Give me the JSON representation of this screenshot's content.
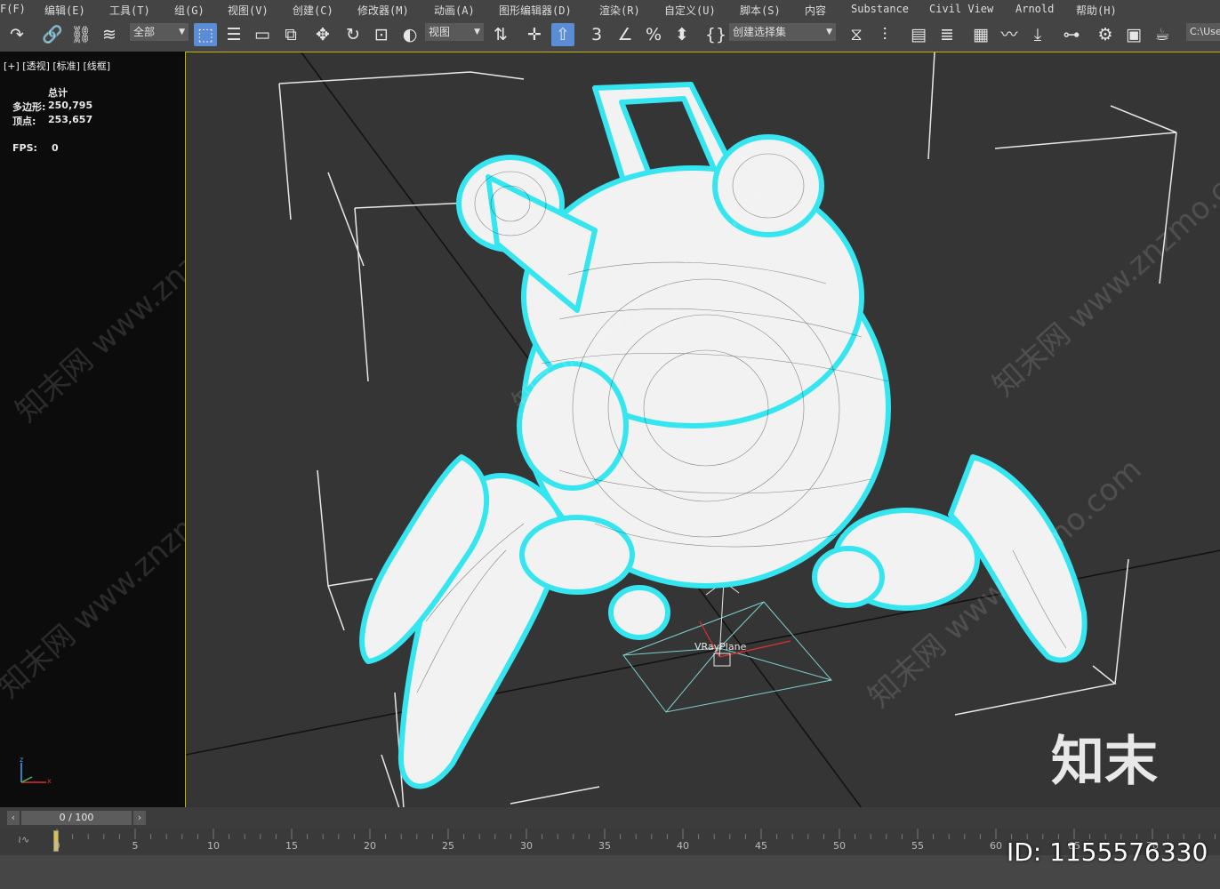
{
  "menubar": {
    "items": [
      "F(F)",
      "编辑(E)",
      "工具(T)",
      "组(G)",
      "视图(V)",
      "创建(C)",
      "修改器(M)",
      "动画(A)",
      "图形编辑器(D)",
      "渲染(R)",
      "自定义(U)",
      "脚本(S)",
      "内容",
      "Substance",
      "Civil View",
      "Arnold",
      "帮助(H)"
    ]
  },
  "toolbar": {
    "selection_filter": "全部",
    "reference_coord": "视图",
    "named_selection": "创建选择集",
    "path_display": "C:\\Use"
  },
  "viewport": {
    "label": "[+] [透视] [标准] [线框]",
    "stats_header": "总计",
    "polys_label": "多边形:",
    "polys_value": "250,795",
    "verts_label": "顶点:",
    "verts_value": "253,657",
    "fps_label": "FPS:",
    "fps_value": "0",
    "object_label": "VRayPlane",
    "watermark": "知末网 www.znzmo.com"
  },
  "timeslider": {
    "counter": "0 / 100",
    "ticks": [
      "0",
      "5",
      "10",
      "15",
      "20",
      "25",
      "30",
      "35",
      "40",
      "45",
      "50",
      "55",
      "60",
      "65",
      "70"
    ]
  },
  "branding": {
    "logo": "知末",
    "id": "ID: 1155576330"
  },
  "colors": {
    "selection_outline": "#35e6f0",
    "wire": "#ffffff",
    "viewport_border": "#c8b400"
  }
}
